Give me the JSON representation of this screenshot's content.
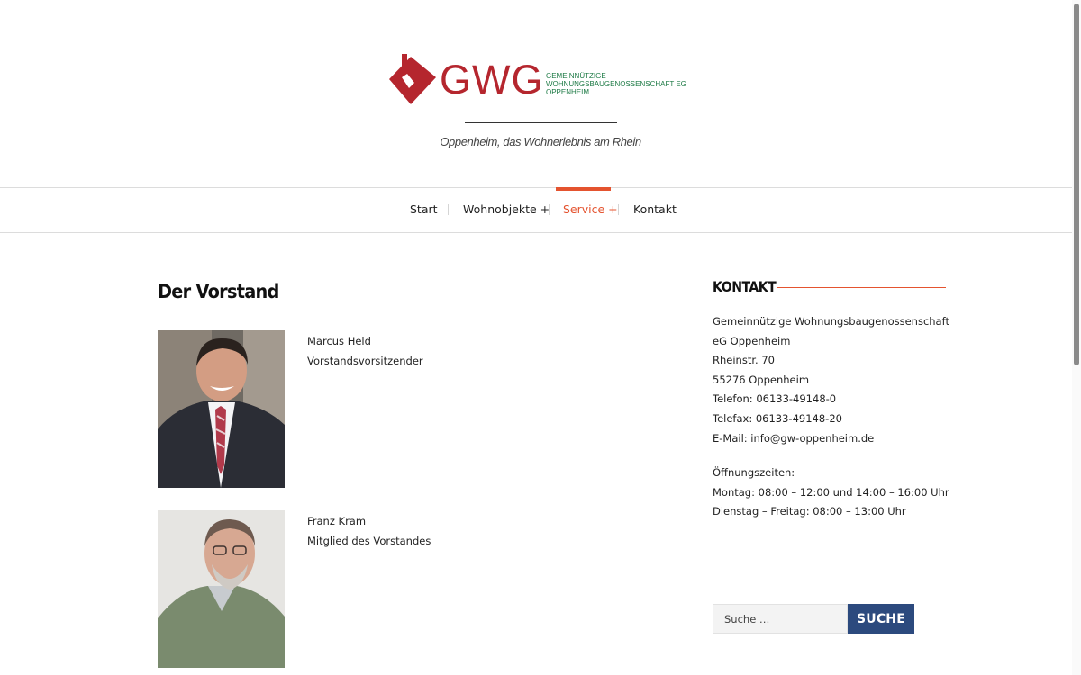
{
  "brand": {
    "wordmark": "GWG",
    "subtitle_lines": [
      "Gemeinnützige",
      "Wohnungsbaugenossenschaft eG",
      "Oppenheim"
    ],
    "tagline": "Oppenheim, das Wohnerlebnis am Rhein",
    "colors": {
      "red": "#b5262e",
      "green": "#1d7a45"
    }
  },
  "nav": {
    "items": [
      {
        "label": "Start"
      },
      {
        "label": "Wohnobjekte +"
      },
      {
        "label": "Service +"
      },
      {
        "label": "Kontakt"
      }
    ],
    "active_index": 2,
    "accent": "#e4532f"
  },
  "main": {
    "title": "Der Vorstand",
    "members": [
      {
        "name": "Marcus Held",
        "role": "Vorstandsvorsitzender"
      },
      {
        "name": "Franz Kram",
        "role": "Mitglied des Vorstandes"
      }
    ]
  },
  "sidebar": {
    "contact_title": "KONTAKT",
    "address_lines": [
      "Gemeinnützige Wohnungsbaugenossenschaft",
      "eG Oppenheim",
      "Rheinstr. 70",
      "55276 Oppenheim",
      "Telefon: 06133-49148-0",
      "Telefax: 06133-49148-20",
      "E-Mail: info@gw-oppenheim.de"
    ],
    "hours_lines": [
      "Öffnungszeiten:",
      "Montag: 08:00 – 12:00 und 14:00 – 16:00 Uhr",
      "Dienstag – Freitag: 08:00 – 13:00 Uhr"
    ],
    "search": {
      "placeholder": "Suche …",
      "button_label": "SUCHE",
      "button_color": "#2c4a7e"
    }
  }
}
